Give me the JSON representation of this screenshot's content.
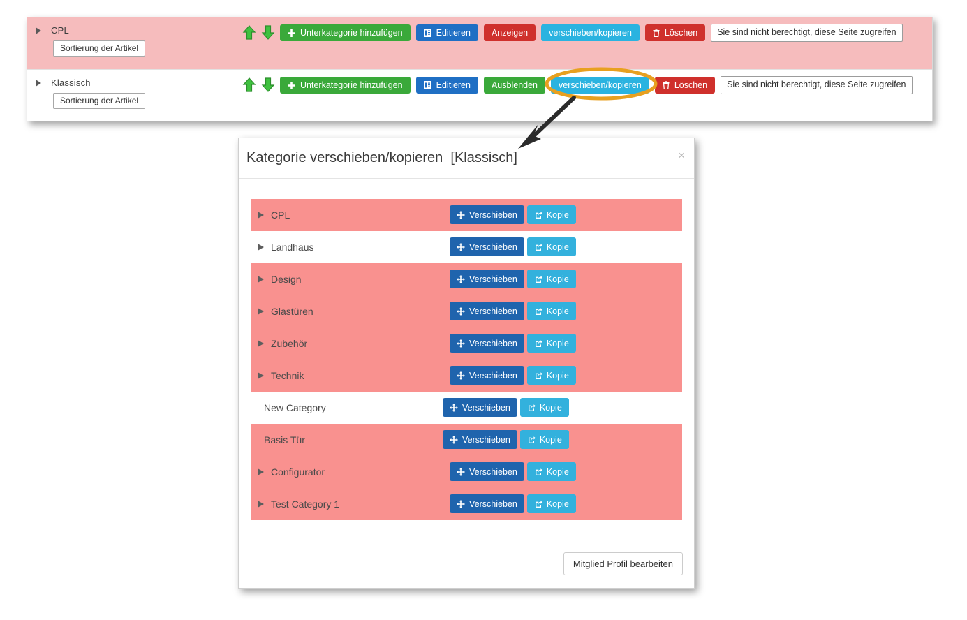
{
  "colors": {
    "row_pink_light": "#f6bcbd",
    "row_pink_selected": "#f9918f",
    "green": "#3aa93a",
    "blue": "#1f6fc4",
    "red": "#cf302c",
    "cyan": "#2ab3e0",
    "move_blue": "#1f64ad",
    "copy_cyan": "#33b1dd",
    "annotation_orange": "#e8a020",
    "arrow_black": "#2b2b2b"
  },
  "admin_panel": {
    "rows": [
      {
        "title": "CPL",
        "highlighted": true,
        "sort_button": "Sortierung der Artikel",
        "move_up_icon": "arrow-up-icon",
        "move_down_icon": "arrow-down-icon",
        "buttons": [
          {
            "label": "Unterkategorie hinzufügen",
            "style": "green",
            "icon": "plus-icon"
          },
          {
            "label": "Editieren",
            "style": "blue",
            "icon": "edit-document-icon"
          },
          {
            "label": "Anzeigen",
            "style": "red",
            "icon": "none"
          },
          {
            "label": "verschieben/kopieren",
            "style": "cyan",
            "icon": "none"
          },
          {
            "label": "Löschen",
            "style": "red",
            "icon": "trash-icon"
          }
        ],
        "note": "Sie sind nicht berechtigt, diese Seite zugreifen"
      },
      {
        "title": "Klassisch",
        "highlighted": false,
        "sort_button": "Sortierung der Artikel",
        "move_up_icon": "arrow-up-icon",
        "move_down_icon": "arrow-down-icon",
        "buttons": [
          {
            "label": "Unterkategorie hinzufügen",
            "style": "green",
            "icon": "plus-icon"
          },
          {
            "label": "Editieren",
            "style": "blue",
            "icon": "edit-document-icon"
          },
          {
            "label": "Ausblenden",
            "style": "green",
            "icon": "none"
          },
          {
            "label": "verschieben/kopieren",
            "style": "cyan",
            "icon": "none"
          },
          {
            "label": "Löschen",
            "style": "red",
            "icon": "trash-icon"
          }
        ],
        "note": "Sie sind nicht berechtigt, diese Seite zugreifen"
      }
    ]
  },
  "annotation": {
    "ellipse_target": "verschieben/kopieren",
    "arrow": "points from highlighted button down-left to modal title"
  },
  "modal": {
    "title": "Kategorie verschieben/kopieren  [Klassisch]",
    "close_label": "×",
    "move_label": "Verschieben",
    "copy_label": "Kopie",
    "move_icon": "arrows-move-icon",
    "copy_icon": "copy-share-icon",
    "footer_button": "Mitglied Profil bearbeiten",
    "rows": [
      {
        "label": "CPL",
        "selected": true,
        "has_arrow": true
      },
      {
        "label": "Landhaus",
        "selected": false,
        "has_arrow": true
      },
      {
        "label": "Design",
        "selected": true,
        "has_arrow": true
      },
      {
        "label": "Glastüren",
        "selected": true,
        "has_arrow": true
      },
      {
        "label": "Zubehör",
        "selected": true,
        "has_arrow": true
      },
      {
        "label": "Technik",
        "selected": true,
        "has_arrow": true
      },
      {
        "label": "New Category",
        "selected": false,
        "has_arrow": false
      },
      {
        "label": "Basis Tür",
        "selected": true,
        "has_arrow": false
      },
      {
        "label": "Configurator",
        "selected": true,
        "has_arrow": true
      },
      {
        "label": "Test Category 1",
        "selected": true,
        "has_arrow": true
      }
    ]
  }
}
